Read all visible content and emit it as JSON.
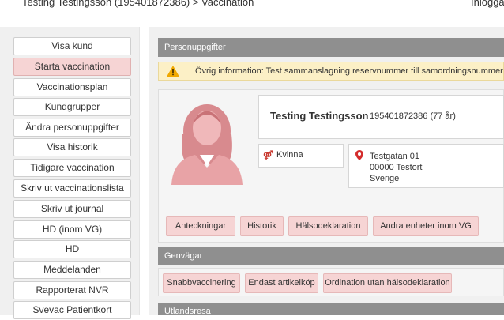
{
  "header": {
    "breadcrumb": "Testing Testingsson (195401872386) > Vaccination",
    "login_status": "Inloggad"
  },
  "sidebar": {
    "items": [
      {
        "label": "Visa kund",
        "active": false
      },
      {
        "label": "Starta vaccination",
        "active": true
      },
      {
        "label": "Vaccinationsplan",
        "active": false
      },
      {
        "label": "Kundgrupper",
        "active": false
      },
      {
        "label": "Ändra personuppgifter",
        "active": false
      },
      {
        "label": "Visa historik",
        "active": false
      },
      {
        "label": "Tidigare vaccination",
        "active": false
      },
      {
        "label": "Skriv ut vaccinationslista",
        "active": false
      },
      {
        "label": "Skriv ut journal",
        "active": false
      },
      {
        "label": "HD (inom VG)",
        "active": false
      },
      {
        "label": "HD",
        "active": false
      },
      {
        "label": "Meddelanden",
        "active": false
      },
      {
        "label": "Rapporterat NVR",
        "active": false
      },
      {
        "label": "Svevac Patientkort",
        "active": false
      }
    ]
  },
  "personuppgifter": {
    "title": "Personuppgifter",
    "warning": "Övrig information: Test sammanslagning reservnummer till samordningsnummer som",
    "patient": {
      "name": "Testing Testingsson",
      "id_age": "195401872386 (77 år)",
      "gender": "Kvinna",
      "address": [
        "Testgatan 01",
        "00000 Testort",
        "Sverige"
      ]
    },
    "buttons": [
      "Anteckningar",
      "Historik",
      "Hälsodeklaration",
      "Andra enheter inom VG"
    ]
  },
  "genvagar": {
    "title": "Genvägar",
    "buttons": [
      "Snabbvaccinering",
      "Endast artikelköp",
      "Ordination utan hälsodeklaration"
    ]
  },
  "utlandsresa": {
    "title": "Utlandsresa"
  },
  "colors": {
    "section_header": "#8f8f8f",
    "pink_button": "#f6d4d4",
    "warning_bg": "#fcf0c6",
    "gender_icon": "#c8372d",
    "pin": "#d42c2c",
    "avatar": "#e8a3a6"
  }
}
